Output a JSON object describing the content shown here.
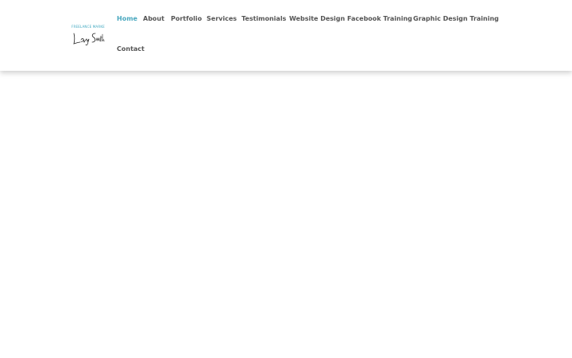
{
  "logo": {
    "tagline": "FREELANCE MARKETING",
    "signature": "Lucy Smith",
    "tagline_color": "#3ba6bf"
  },
  "nav": {
    "active_color": "#4aa8bf",
    "text_color": "#555555",
    "items": [
      {
        "label": "Home",
        "active": true
      },
      {
        "label": "About"
      },
      {
        "label": "Portfolio"
      },
      {
        "label": "Services"
      },
      {
        "label": "Testimonials"
      },
      {
        "label": "Website Design"
      },
      {
        "label": "Facebook Training"
      },
      {
        "label": "Graphic Design Training"
      },
      {
        "label": "Contact"
      }
    ]
  }
}
